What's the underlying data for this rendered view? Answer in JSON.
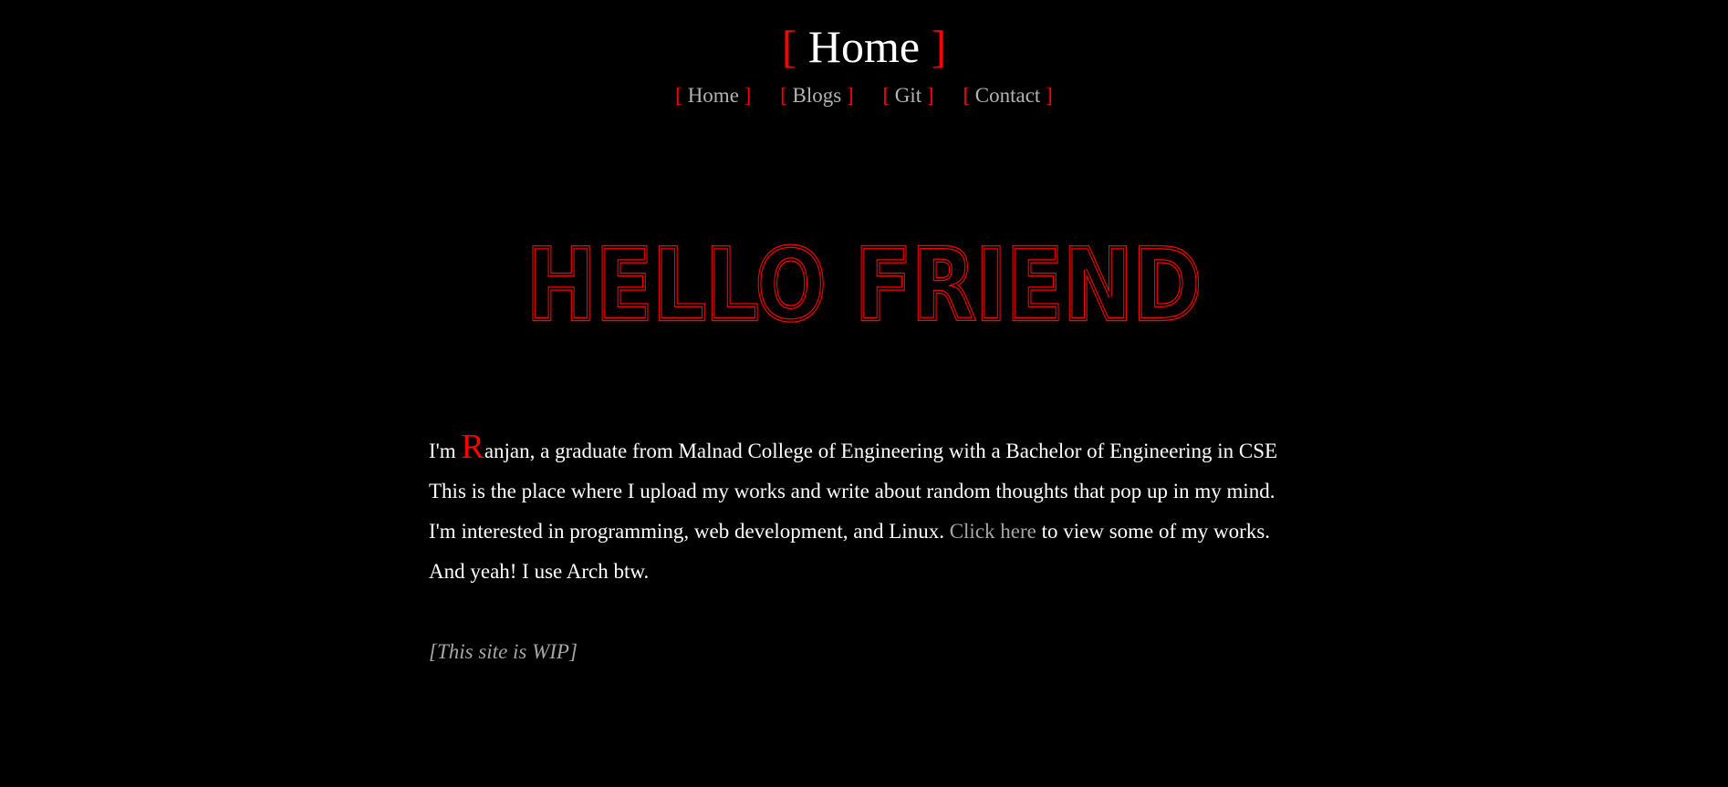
{
  "header": {
    "bracket_open": "[",
    "title": "Home",
    "bracket_close": "]"
  },
  "nav": {
    "items": [
      {
        "label": "Home"
      },
      {
        "label": "Blogs"
      },
      {
        "label": "Git"
      },
      {
        "label": "Contact"
      }
    ]
  },
  "hero": {
    "text": "HELLO FRIEND",
    "color": "#ff0000"
  },
  "intro": {
    "line1_prefix": "I'm ",
    "drop_cap": "R",
    "line1_rest": "anjan, a graduate from Malnad College of Engineering with a Bachelor of Engineering in CSE",
    "line2": "This is the place where I upload my works and write about random thoughts that pop up in my mind.",
    "line3_prefix": "I'm interested in programming, web development, and Linux. ",
    "line3_link": "Click here",
    "line3_suffix": " to view some of my works.",
    "line4": "And yeah! I use Arch btw.",
    "wip": "[This site is WIP]"
  },
  "colors": {
    "background": "#000000",
    "accent": "#ff0000",
    "text": "#ffffff",
    "muted": "#a6a6a6"
  }
}
